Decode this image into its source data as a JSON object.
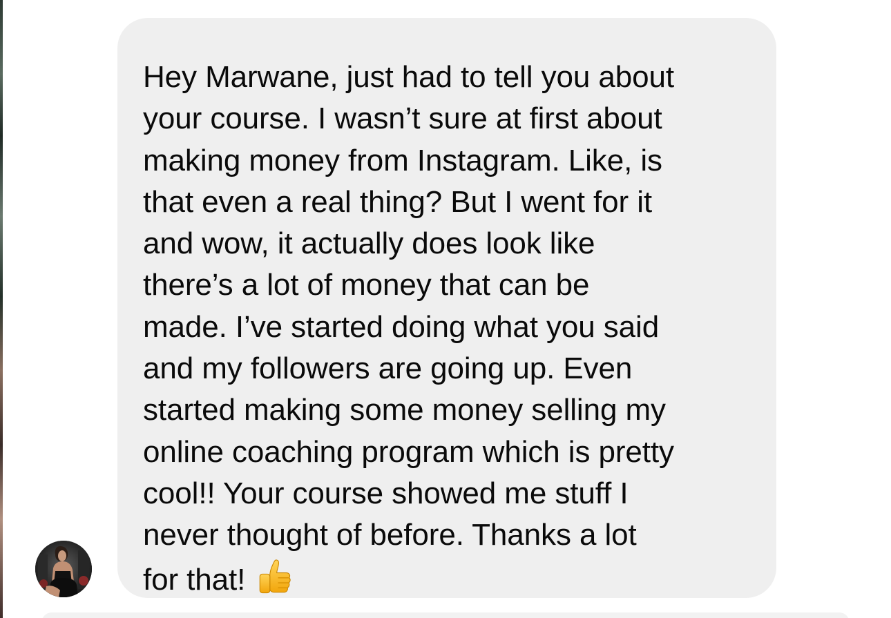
{
  "message": {
    "lines": [
      "Hey Marwane, just had to tell you about",
      "your course. I wasn’t sure at first about",
      "making money from Instagram. Like, is",
      "that even a real thing? But I went for it",
      "and wow, it actually does look like",
      "there’s a lot of money that can be",
      "made. I’ve started doing what you said",
      "and my followers are going up. Even",
      "started making some money selling my",
      "online coaching program which is pretty",
      "cool!! Your course showed me stuff I",
      "never thought of before. Thanks a lot",
      "for that!"
    ],
    "emoji": "thumbs-up",
    "bubble_color": "#efefef",
    "text_color": "#0a0a0a"
  },
  "sender": {
    "avatar_icon": "profile-photo"
  }
}
